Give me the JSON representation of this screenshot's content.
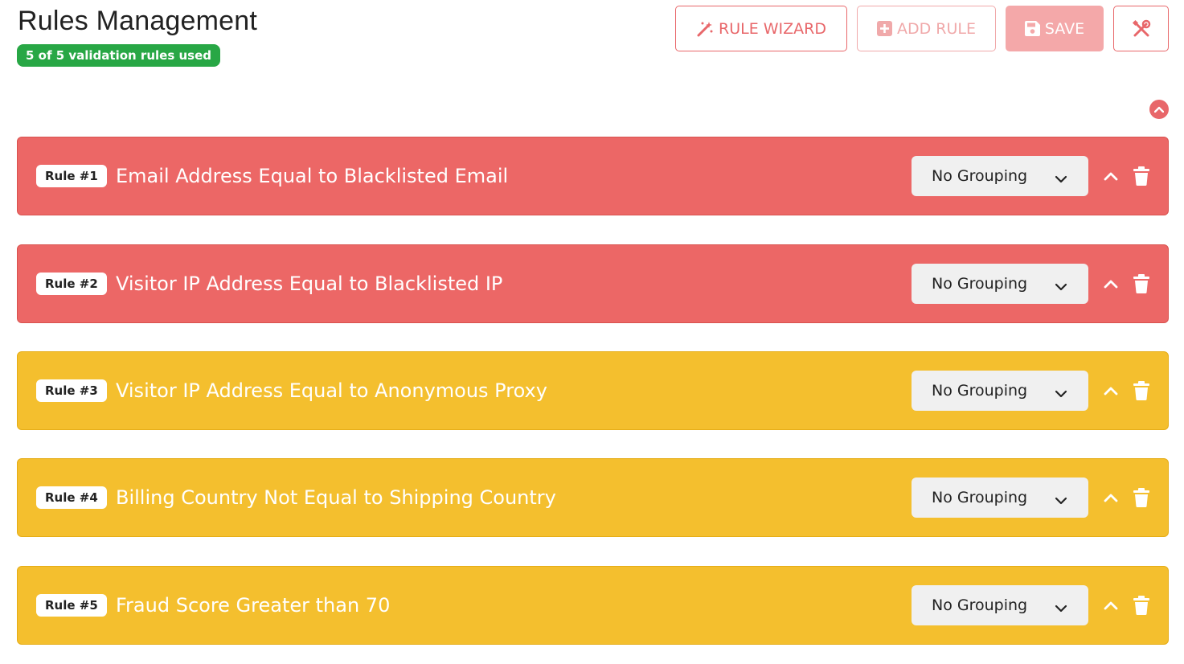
{
  "header": {
    "title": "Rules Management",
    "usage_badge": "5 of 5 validation rules used"
  },
  "toolbar": {
    "wizard_label": "RULE WIZARD",
    "wizard_icon": "magic-wand-icon",
    "add_label": "ADD RULE",
    "add_icon": "plus-square-icon",
    "save_label": "SAVE",
    "save_icon": "floppy-disk-icon",
    "tools_icon": "tools-icon"
  },
  "colors": {
    "accent": "#e8676a",
    "badge_green": "#28a745",
    "rule_red": "#ec6766",
    "rule_yellow": "#f4bf2e"
  },
  "rules": [
    {
      "badge": "Rule #1",
      "title": "Email Address Equal to Blacklisted Email",
      "grouping": "No Grouping",
      "severity_color": "red"
    },
    {
      "badge": "Rule #2",
      "title": "Visitor IP Address Equal to Blacklisted IP",
      "grouping": "No Grouping",
      "severity_color": "red"
    },
    {
      "badge": "Rule #3",
      "title": "Visitor IP Address Equal to Anonymous Proxy",
      "grouping": "No Grouping",
      "severity_color": "yellow"
    },
    {
      "badge": "Rule #4",
      "title": "Billing Country Not Equal to Shipping Country",
      "grouping": "No Grouping",
      "severity_color": "yellow"
    },
    {
      "badge": "Rule #5",
      "title": "Fraud Score Greater than 70",
      "grouping": "No Grouping",
      "severity_color": "yellow"
    }
  ]
}
